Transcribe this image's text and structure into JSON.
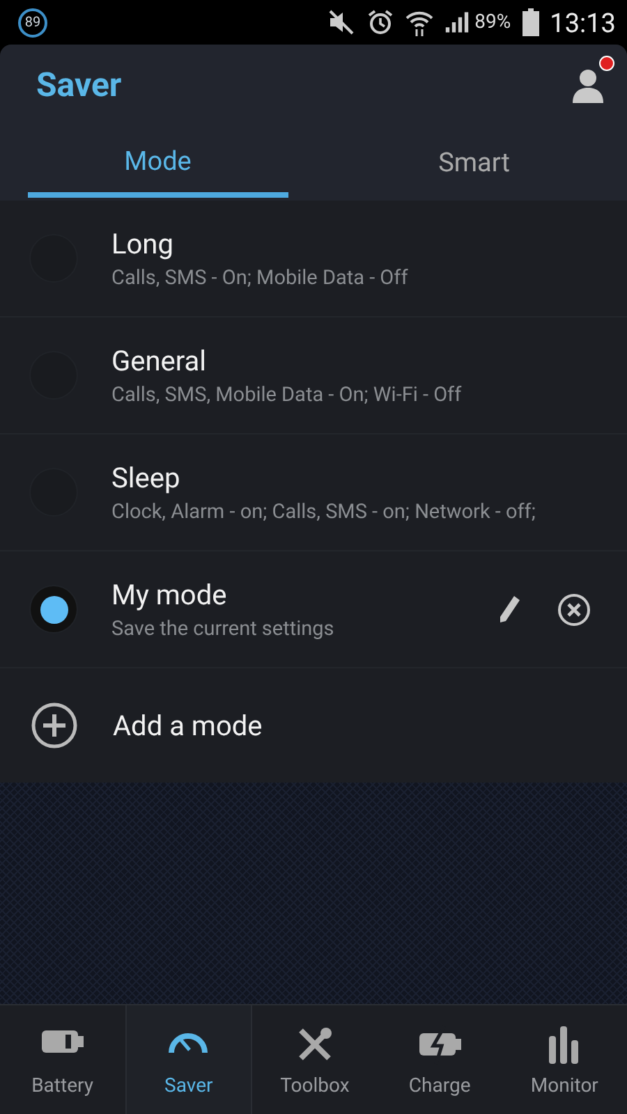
{
  "status_bar": {
    "badge": "89",
    "battery_percent": "89%",
    "time": "13:13"
  },
  "header": {
    "title": "Saver",
    "notification": true
  },
  "tabs": [
    {
      "label": "Mode",
      "selected": true
    },
    {
      "label": "Smart",
      "selected": false
    }
  ],
  "modes": [
    {
      "kind": "preset",
      "name": "Long",
      "description": "Calls, SMS - On; Mobile Data - Off",
      "selected": false
    },
    {
      "kind": "preset",
      "name": "General",
      "description": "Calls, SMS, Mobile Data - On; Wi-Fi - Off",
      "selected": false
    },
    {
      "kind": "preset",
      "name": "Sleep",
      "description": "Clock, Alarm - on; Calls, SMS - on; Network - off;",
      "selected": false
    },
    {
      "kind": "custom",
      "name": "My mode",
      "description": "Save the current settings",
      "selected": true
    }
  ],
  "add_mode": {
    "label": "Add a mode"
  },
  "bottom_nav": [
    {
      "kind": "battery",
      "label": "Battery",
      "selected": false
    },
    {
      "kind": "gauge",
      "label": "Saver",
      "selected": true
    },
    {
      "kind": "tools",
      "label": "Toolbox",
      "selected": false
    },
    {
      "kind": "charge",
      "label": "Charge",
      "selected": false
    },
    {
      "kind": "bars",
      "label": "Monitor",
      "selected": false
    }
  ]
}
